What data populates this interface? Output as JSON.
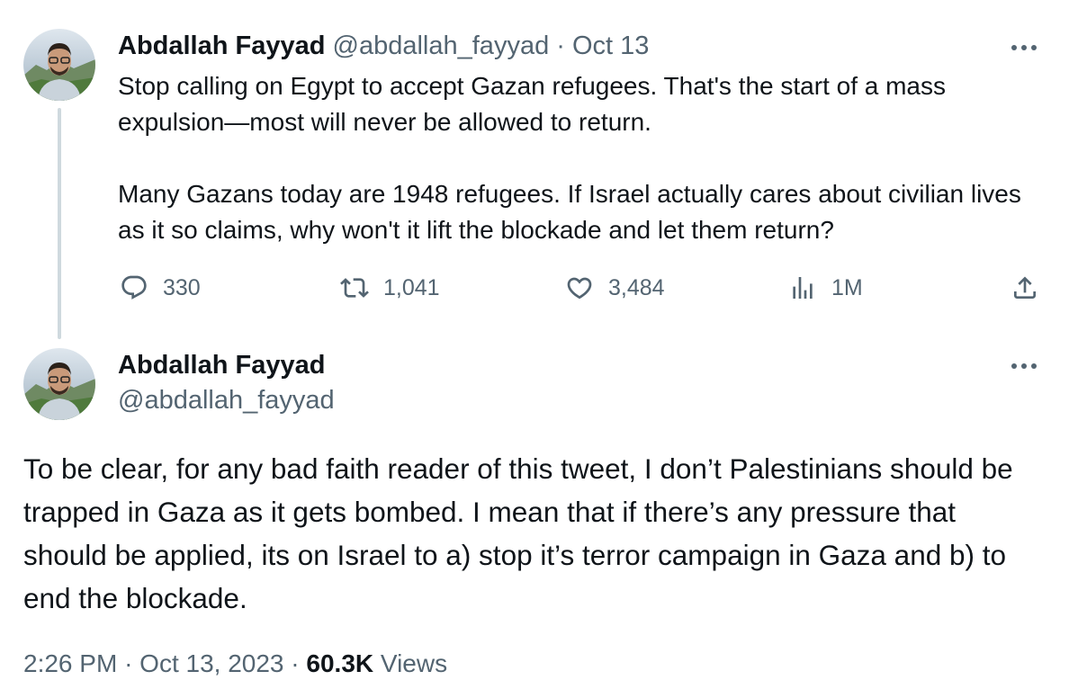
{
  "tweet1": {
    "name": "Abdallah Fayyad",
    "handle": "@abdallah_fayyad",
    "separator": "·",
    "date": "Oct 13",
    "paragraphs": [
      "Stop calling on Egypt to accept Gazan refugees. That's the start of a mass expulsion—most will never be allowed to return.",
      "Many Gazans today are 1948 refugees. If Israel actually cares about civilian lives as it so claims, why won't it lift the blockade and let them return?"
    ],
    "stats": {
      "replies": "330",
      "retweets": "1,041",
      "likes": "3,484",
      "views": "1M"
    }
  },
  "tweet2": {
    "name": "Abdallah Fayyad",
    "handle": "@abdallah_fayyad",
    "text": "To be clear, for any bad faith reader of this tweet, I don’t Palestinians should be trapped in Gaza as it gets bombed. I mean that if there’s any pressure that should be applied, its on Israel to a) stop it’s terror campaign in Gaza and b) to end the blockade.",
    "time": "2:26 PM",
    "date": "Oct 13, 2023",
    "separator": "·",
    "views_count": "60.3K",
    "views_label": "Views"
  },
  "icons": {
    "more": "more-horizontal-icon",
    "reply": "reply-icon",
    "retweet": "retweet-icon",
    "like": "heart-icon",
    "views": "analytics-icon",
    "share": "share-icon"
  },
  "colors": {
    "text": "#0f1419",
    "muted": "#536471",
    "thread_line": "#cfd9de"
  }
}
